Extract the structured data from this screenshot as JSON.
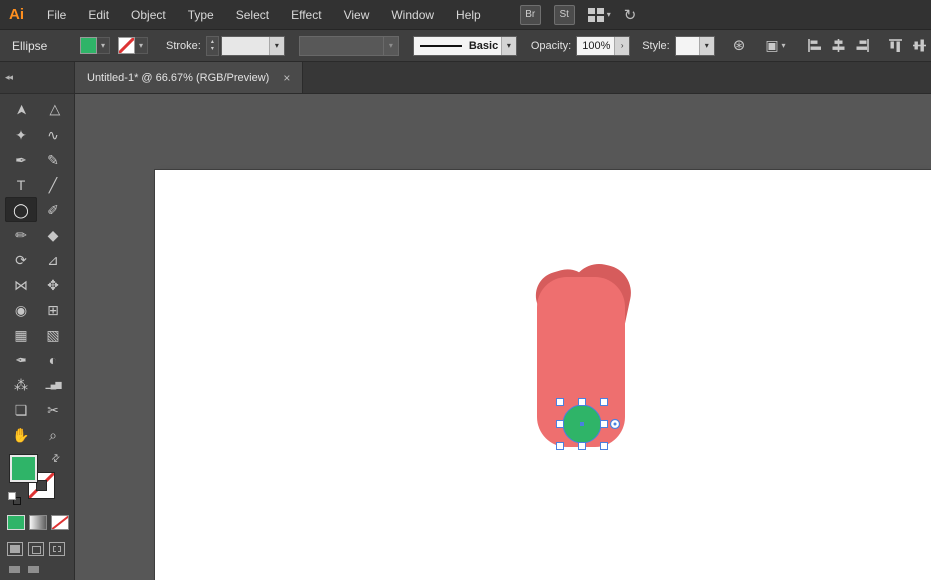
{
  "colors": {
    "fill_green": "#2fb468",
    "coral": "#ee6f6f",
    "coral_dark": "#d65c5c",
    "selection_blue": "#4a80e0",
    "stroke_none_red": "#dd3333"
  },
  "menubar": {
    "logo": "Ai",
    "items": [
      "File",
      "Edit",
      "Object",
      "Type",
      "Select",
      "Effect",
      "View",
      "Window",
      "Help"
    ],
    "badges": [
      {
        "name": "bridge-badge",
        "label": "Br"
      },
      {
        "name": "stock-badge",
        "label": "St"
      }
    ]
  },
  "controlbar": {
    "tool_label": "Ellipse",
    "stroke_label": "Stroke:",
    "stroke_style_value": "Basic",
    "opacity_label": "Opacity:",
    "opacity_value": "100%",
    "style_label": "Style:"
  },
  "icons": {
    "caret": "▾",
    "caret_up": "▴",
    "chevron": "›",
    "close": "×",
    "collapse": "◂◂",
    "swap": "⇄",
    "recolor": "⊛",
    "document": "▣",
    "sync": "↻"
  },
  "tab": {
    "title": "Untitled-1* @ 66.67% (RGB/Preview)"
  },
  "tools": {
    "items": [
      {
        "name": "selection-tool",
        "glyph": "➤",
        "cls": "g-up"
      },
      {
        "name": "direct-selection-tool",
        "glyph": "▷",
        "cls": "g-up"
      },
      {
        "name": "magic-wand-tool",
        "glyph": "✦"
      },
      {
        "name": "lasso-tool",
        "glyph": "∿"
      },
      {
        "name": "pen-tool",
        "glyph": "✒"
      },
      {
        "name": "curvature-tool",
        "glyph": "✎"
      },
      {
        "name": "type-tool",
        "glyph": "T"
      },
      {
        "name": "line-segment-tool",
        "glyph": "╱"
      },
      {
        "name": "ellipse-tool",
        "glyph": "◯",
        "selected": true
      },
      {
        "name": "paintbrush-tool",
        "glyph": "✐"
      },
      {
        "name": "shaper-tool",
        "glyph": "✏"
      },
      {
        "name": "eraser-tool",
        "glyph": "◆"
      },
      {
        "name": "rotate-tool",
        "glyph": "⟳"
      },
      {
        "name": "scale-tool",
        "glyph": "⊿"
      },
      {
        "name": "width-tool",
        "glyph": "⋈"
      },
      {
        "name": "free-transform-tool",
        "glyph": "✥"
      },
      {
        "name": "shape-builder-tool",
        "glyph": "◉"
      },
      {
        "name": "perspective-grid-tool",
        "glyph": "⊞"
      },
      {
        "name": "mesh-tool",
        "glyph": "▦"
      },
      {
        "name": "gradient-tool",
        "glyph": "▧"
      },
      {
        "name": "eyedropper-tool",
        "glyph": "✒",
        "cls": "g-flip"
      },
      {
        "name": "blend-tool",
        "glyph": "◐"
      },
      {
        "name": "symbol-sprayer-tool",
        "glyph": "⁂"
      },
      {
        "name": "column-graph-tool",
        "glyph": "▁▄▆",
        "cls": "g-small"
      },
      {
        "name": "artboard-tool",
        "glyph": "❏"
      },
      {
        "name": "slice-tool",
        "glyph": "✂"
      },
      {
        "name": "hand-tool",
        "glyph": "✋"
      },
      {
        "name": "zoom-tool",
        "glyph": "⌕"
      }
    ]
  }
}
